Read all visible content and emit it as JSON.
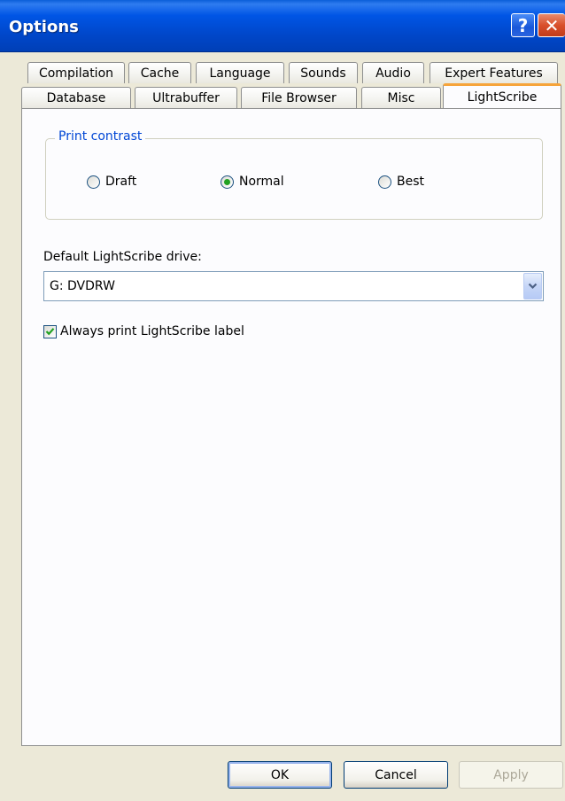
{
  "window": {
    "title": "Options",
    "help_label": "?",
    "close_label": "✕"
  },
  "tabs_row1": [
    {
      "label": "Compilation"
    },
    {
      "label": "Cache"
    },
    {
      "label": "Language"
    },
    {
      "label": "Sounds"
    },
    {
      "label": "Audio"
    },
    {
      "label": "Expert Features"
    }
  ],
  "tabs_row2": [
    {
      "label": "Database"
    },
    {
      "label": "Ultrabuffer"
    },
    {
      "label": "File Browser"
    },
    {
      "label": "Misc"
    },
    {
      "label": "LightScribe",
      "active": true
    }
  ],
  "print_contrast": {
    "legend": "Print contrast",
    "options": [
      {
        "label": "Draft",
        "selected": false
      },
      {
        "label": "Normal",
        "selected": true
      },
      {
        "label": "Best",
        "selected": false
      }
    ]
  },
  "drive": {
    "label": "Default LightScribe drive:",
    "value": "G: DVDRW"
  },
  "always_print": {
    "label": "Always print LightScribe label",
    "checked": true
  },
  "buttons": {
    "ok": "OK",
    "cancel": "Cancel",
    "apply": "Apply"
  },
  "colors": {
    "accent_tab": "#F6A43A",
    "legend_text": "#0046D5",
    "radio_dot": "#21A121",
    "check_mark": "#21A121"
  }
}
